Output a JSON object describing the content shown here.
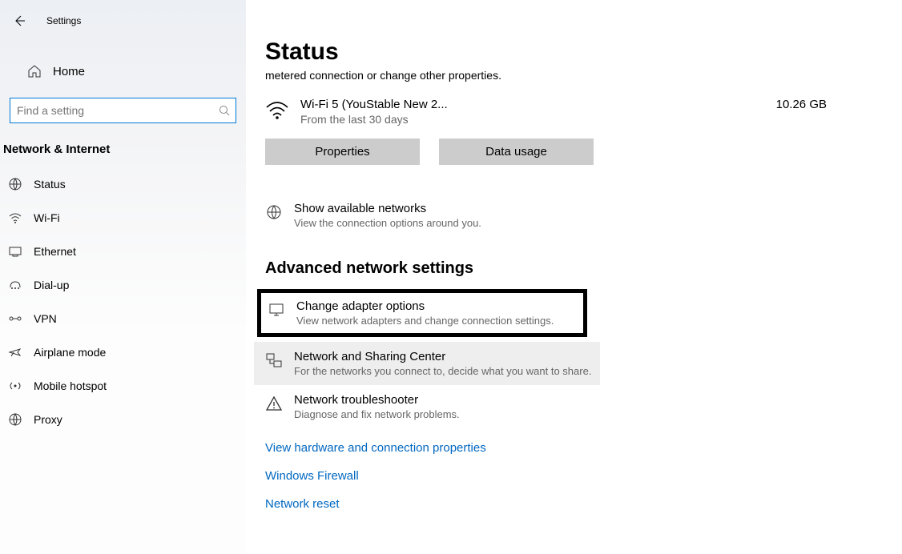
{
  "app": {
    "title": "Settings"
  },
  "sidebar": {
    "home": "Home",
    "search_placeholder": "Find a setting",
    "category": "Network & Internet",
    "items": [
      {
        "label": "Status"
      },
      {
        "label": "Wi-Fi"
      },
      {
        "label": "Ethernet"
      },
      {
        "label": "Dial-up"
      },
      {
        "label": "VPN"
      },
      {
        "label": "Airplane mode"
      },
      {
        "label": "Mobile hotspot"
      },
      {
        "label": "Proxy"
      }
    ]
  },
  "main": {
    "title": "Status",
    "cutoff": "metered connection or change other properties.",
    "network": {
      "name": "Wi-Fi 5 (YouStable New 2...",
      "sub": "From the last 30 days",
      "usage": "10.26 GB"
    },
    "buttons": {
      "properties": "Properties",
      "datausage": "Data usage"
    },
    "available": {
      "title": "Show available networks",
      "sub": "View the connection options around you."
    },
    "section": "Advanced network settings",
    "adapter": {
      "title": "Change adapter options",
      "sub": "View network adapters and change connection settings."
    },
    "sharing": {
      "title": "Network and Sharing Center",
      "sub": "For the networks you connect to, decide what you want to share."
    },
    "troubleshoot": {
      "title": "Network troubleshooter",
      "sub": "Diagnose and fix network problems."
    },
    "links": {
      "l1": "View hardware and connection properties",
      "l2": "Windows Firewall",
      "l3": "Network reset"
    }
  }
}
